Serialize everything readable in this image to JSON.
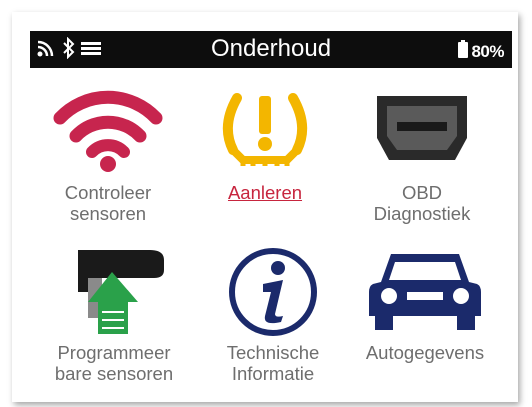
{
  "statusbar": {
    "title": "Onderhoud",
    "battery_label": "80%",
    "icons": [
      "signal-icon",
      "bluetooth-icon",
      "menu-icon",
      "battery-icon"
    ]
  },
  "colors": {
    "wifi_red": "#c7254e",
    "tpms_yellow": "#f3b600",
    "dark": "#2a2a2a",
    "navy": "#1b2a6b",
    "green_arrow": "#2aa14a",
    "active_label": "#c7253e",
    "label_gray": "#6e6e6e"
  },
  "tiles": [
    {
      "label_line1": "Controleer",
      "label_line2": "sensoren",
      "icon": "wifi-icon"
    },
    {
      "label_line1": "Aanleren",
      "label_line2": "",
      "icon": "tpms-warning-icon",
      "selected": true
    },
    {
      "label_line1": "OBD",
      "label_line2": "Diagnostiek",
      "icon": "obd-connector-icon"
    },
    {
      "label_line1": "Programmeer",
      "label_line2": "bare sensoren",
      "icon": "program-sensor-icon"
    },
    {
      "label_line1": "Technische",
      "label_line2": "Informatie",
      "icon": "info-icon"
    },
    {
      "label_line1": "Autogegevens",
      "label_line2": "",
      "icon": "car-icon"
    }
  ]
}
